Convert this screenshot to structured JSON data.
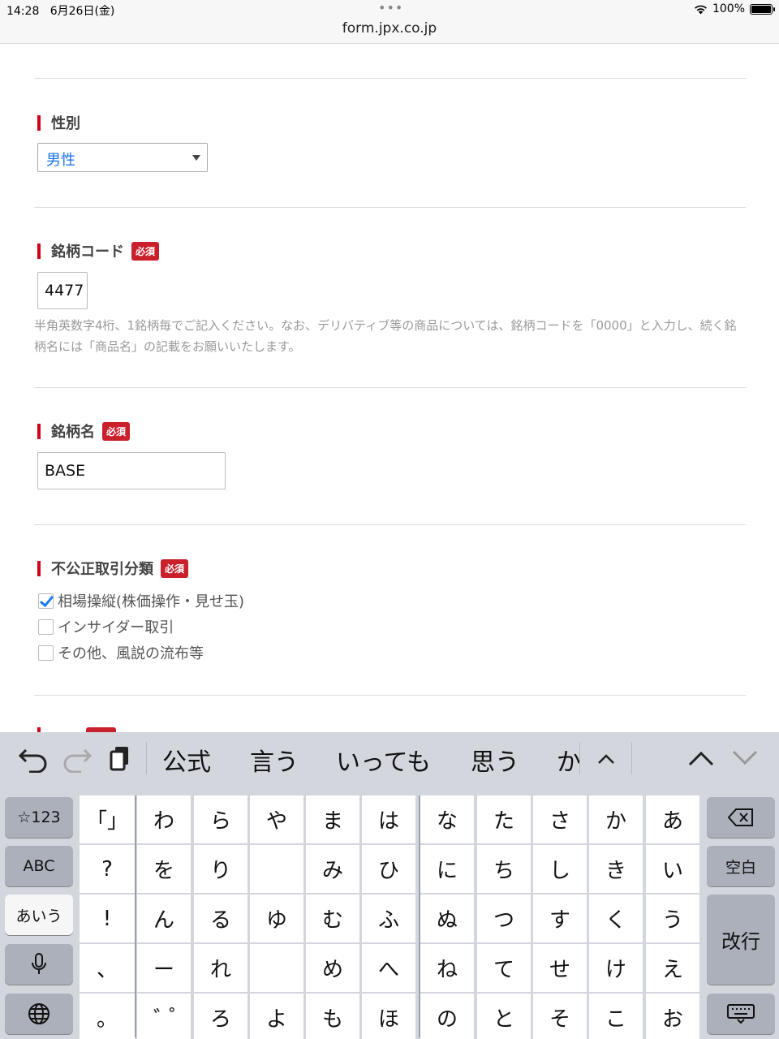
{
  "status": {
    "time": "14:28",
    "date": "6月26日(金)",
    "dots": "•••",
    "battery": "100%"
  },
  "browser": {
    "url": "form.jpx.co.jp"
  },
  "form": {
    "gender": {
      "label": "性別",
      "value": "男性"
    },
    "code": {
      "label": "銘柄コード",
      "required": "必須",
      "value": "4477",
      "help": "半角英数字4桁、1銘柄毎でご記入ください。なお、デリバティブ等の商品については、銘柄コードを「0000」と入力し、続く銘柄名には「商品名」の記載をお願いいたします。"
    },
    "name": {
      "label": "銘柄名",
      "required": "必須",
      "value": "BASE"
    },
    "category": {
      "label": "不公正取引分類",
      "required": "必須",
      "options": [
        {
          "label": "相場操縦(株価操作・見せ玉)",
          "checked": true
        },
        {
          "label": "インサイダー取引",
          "checked": false
        },
        {
          "label": "その他、風説の流布等",
          "checked": false
        }
      ]
    }
  },
  "keyboard": {
    "suggestions": [
      "公式",
      "言う",
      "いっても",
      "思う",
      "か"
    ],
    "left_keys": [
      "☆123",
      "ABC",
      "あいう"
    ],
    "right_keys": [
      "空白",
      "改行"
    ],
    "punct_col": [
      "「」",
      "?",
      "!",
      "、",
      "。"
    ],
    "kana_cols": [
      [
        "わ",
        "を",
        "ん",
        "ー",
        "゛゚"
      ],
      [
        "ら",
        "り",
        "る",
        "れ",
        "ろ"
      ],
      [
        "や",
        "",
        "ゆ",
        "",
        "よ"
      ],
      [
        "ま",
        "み",
        "む",
        "め",
        "も"
      ],
      [
        "は",
        "ひ",
        "ふ",
        "へ",
        "ほ"
      ],
      [
        "な",
        "に",
        "ぬ",
        "ね",
        "の"
      ],
      [
        "た",
        "ち",
        "つ",
        "て",
        "と"
      ],
      [
        "さ",
        "し",
        "す",
        "せ",
        "そ"
      ],
      [
        "か",
        "き",
        "く",
        "け",
        "こ"
      ],
      [
        "あ",
        "い",
        "う",
        "え",
        "お"
      ]
    ]
  }
}
